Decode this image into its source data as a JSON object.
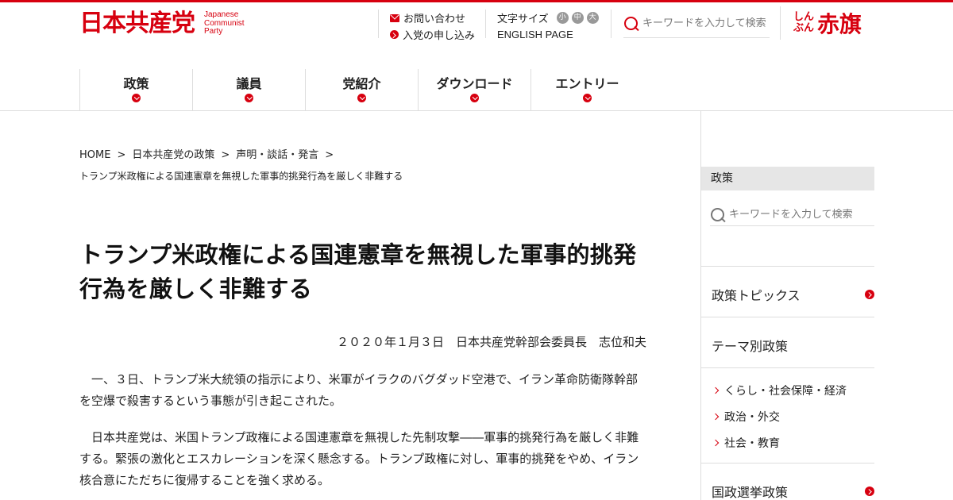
{
  "header": {
    "logo_jp": "日本共産党",
    "logo_en": [
      "Japanese",
      "Communist",
      "Party"
    ],
    "contact_label": "お問い合わせ",
    "join_label": "入党の申し込み",
    "font_size_label": "文字サイズ",
    "font_sizes": [
      "小",
      "中",
      "大"
    ],
    "english_label": "ENGLISH PAGE",
    "search_placeholder": "キーワードを入力して検索",
    "akahata_small_1": "しん",
    "akahata_small_2": "ぶん",
    "akahata_big": "赤旗"
  },
  "nav": {
    "items": [
      "政策",
      "議員",
      "党紹介",
      "ダウンロード",
      "エントリー"
    ]
  },
  "breadcrumb": {
    "items": [
      "HOME",
      "日本共産党の政策",
      "声明・談話・発言"
    ],
    "separator": ">",
    "current": "トランプ米政権による国連憲章を無視した軍事的挑発行為を厳しく非難する"
  },
  "article": {
    "title": "トランプ米政権による国連憲章を無視した軍事的挑発行為を厳しく非難する",
    "byline": "２０２０年１月３日　日本共産党幹部会委員長　志位和夫",
    "paragraphs": [
      "一、３日、トランプ米大統領の指示により、米軍がイラクのバグダッド空港で、イラン革命防衛隊幹部を空爆で殺害するという事態が引き起こされた。",
      "日本共産党は、米国トランプ政権による国連憲章を無視した先制攻撃――軍事的挑発行為を厳しく非難する。緊張の激化とエスカレーションを深く懸念する。トランプ政権に対し、軍事的挑発をやめ、イラン核合意にただちに復帰することを強く求める。"
    ]
  },
  "sidebar": {
    "heading": "政策",
    "search_placeholder": "キーワードを入力して検索",
    "cat_topics": "政策トピックス",
    "cat_theme": "テーマ別政策",
    "sub_items": [
      "くらし・社会保障・経済",
      "政治・外交",
      "社会・教育"
    ],
    "cat_election": "国政選挙政策"
  },
  "colors": {
    "brand_red": "#d7000f",
    "rule_gray": "#dddddd",
    "sidebar_head_bg": "#e6e6e6"
  }
}
